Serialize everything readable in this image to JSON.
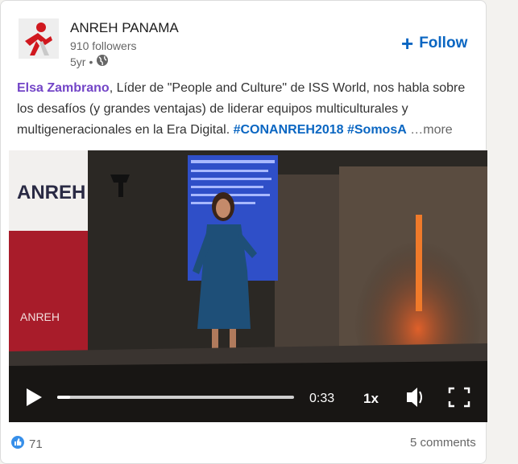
{
  "post": {
    "company": "ANREH PANAMA",
    "followers": "910 followers",
    "age": "5yr",
    "visibility_icon": "globe-icon",
    "follow_label": "Follow"
  },
  "caption": {
    "mention": "Elsa Zambrano",
    "text": ", Líder de \"People and Culture\" de ISS World, nos habla sobre los desafíos (y grandes ventajas) de liderar equipos multiculturales y multigeneracionales en la Era Digital. ",
    "hashtag1": "#CONANREH2018",
    "hashtag2": "#SomosA",
    "more": "…more"
  },
  "video": {
    "banner_text": "ANREH",
    "poster_small_text": "ANREH",
    "time": "0:33",
    "speed": "1x",
    "progress": 0.055
  },
  "social": {
    "reaction_count": "71",
    "comments": "5 comments"
  },
  "colors": {
    "brand_blue": "#0a66c2",
    "mention_purple": "#7345c7"
  }
}
